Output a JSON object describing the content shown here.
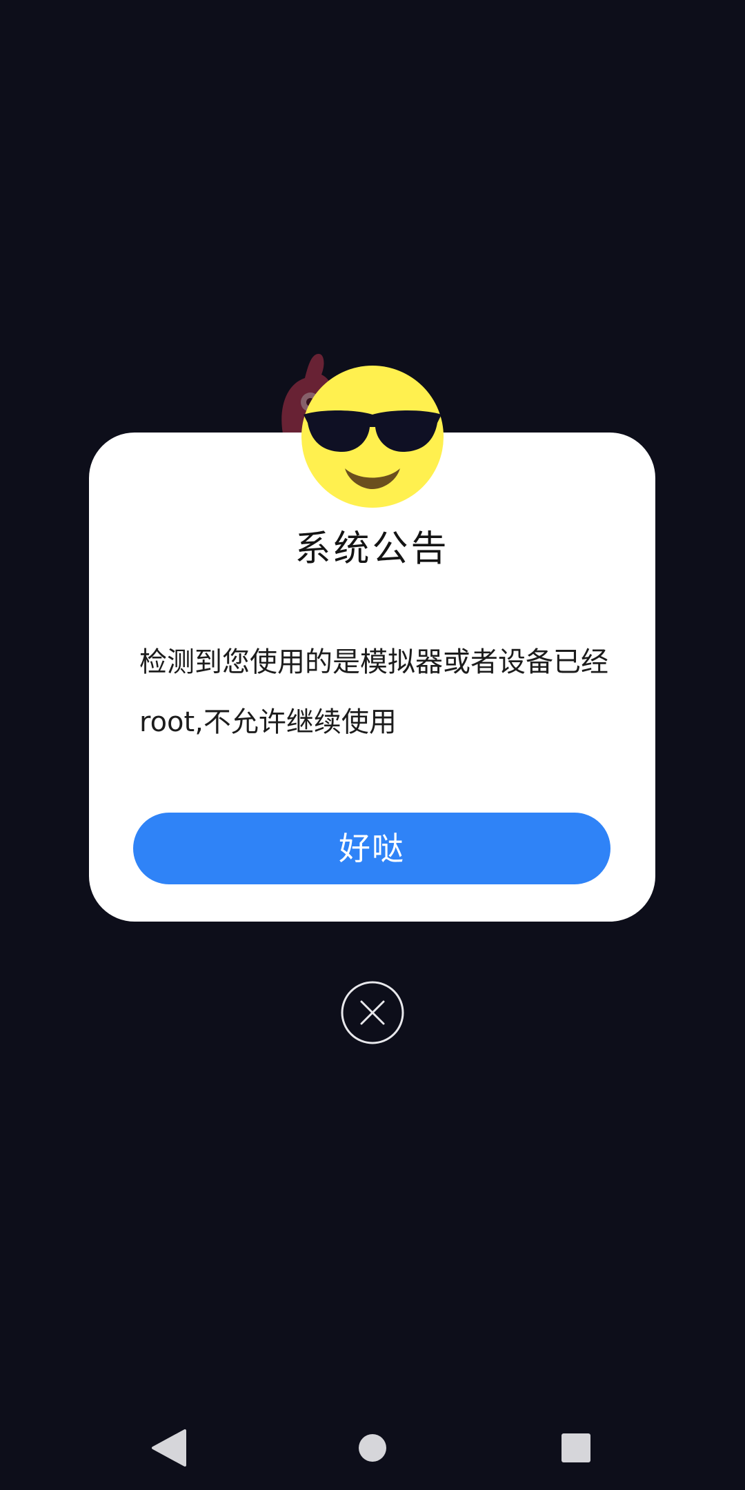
{
  "dialog": {
    "title": "系统公告",
    "message": "检测到您使用的是模拟器或者设备已经root,不允许继续使用",
    "confirm_label": "好哒"
  },
  "icons": {
    "emoji": "smiling-face-with-sunglasses-icon",
    "close": "close-icon",
    "nav_back": "back-icon",
    "nav_home": "home-icon",
    "nav_recent": "recent-apps-icon"
  },
  "colors": {
    "background": "#0d0e1a",
    "dialog": "#ffffff",
    "accent": "#2f83f7",
    "emoji_face": "#fff04f"
  }
}
